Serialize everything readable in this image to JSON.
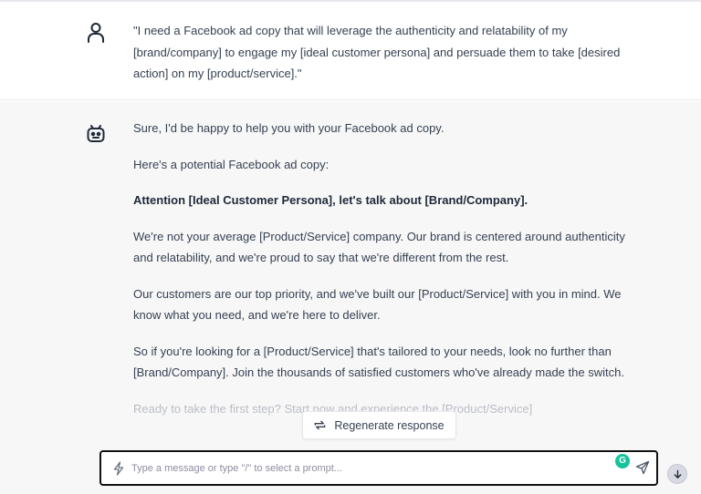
{
  "conversation": {
    "user_message": "\"I need a Facebook ad copy that will leverage the authenticity and relatability of my [brand/company] to engage my [ideal customer persona] and persuade them to take [desired action] on my [product/service].\"",
    "assistant": {
      "intro": "Sure, I'd be happy to help you with your Facebook ad copy.",
      "lead": "Here's a potential Facebook ad copy:",
      "headline": "Attention [Ideal Customer Persona], let's talk about [Brand/Company].",
      "paragraph_1": "We're not your average [Product/Service] company. Our brand is centered around authenticity and relatability, and we're proud to say that we're different from the rest.",
      "paragraph_2": "Our customers are our top priority, and we've built our [Product/Service] with you in mind. We know what you need, and we're here to deliver.",
      "paragraph_3": "So if you're looking for a [Product/Service] that's tailored to your needs, look no further than [Brand/Company]. Join the thousands of satisfied customers who've already made the switch.",
      "paragraph_4_partial": "Ready to take the first step? Start now and experience the [Product/Service]"
    }
  },
  "regenerate": {
    "label": "Regenerate response",
    "icon": "regenerate-icon"
  },
  "composer": {
    "placeholder": "Type a message or type \"/\" to select a prompt...",
    "value": "",
    "left_icon": "bolt-icon",
    "send_icon": "send-icon",
    "extension_icon": "grammarly-icon",
    "extension_letter": "G"
  },
  "scroll_button": {
    "icon": "arrow-down-icon"
  },
  "colors": {
    "assistant_bg": "#f7f7f8",
    "user_bg": "#ffffff",
    "text": "#374151",
    "grammarly_green": "#15c39a"
  }
}
